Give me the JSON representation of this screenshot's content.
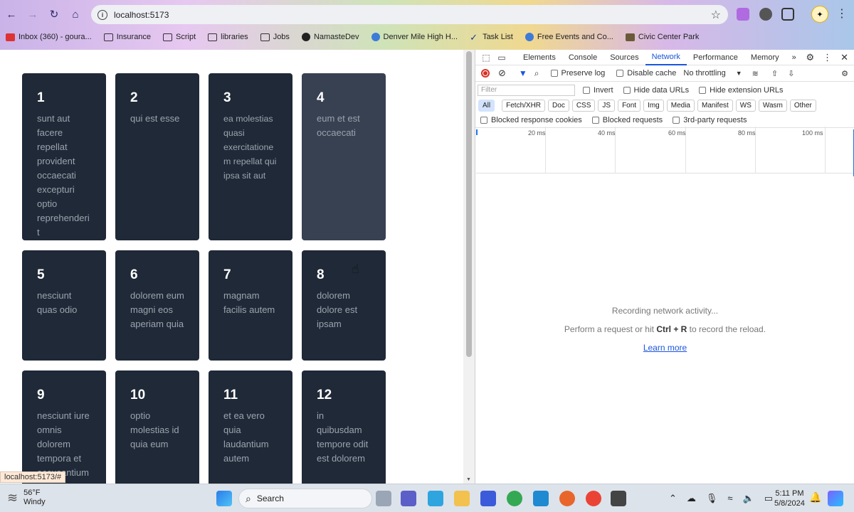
{
  "browser": {
    "url": "localhost:5173",
    "bookmarks": [
      {
        "label": "Inbox (360) - goura...",
        "icon": "gmail-icon"
      },
      {
        "label": "Insurance",
        "icon": "folder-icon"
      },
      {
        "label": "Script",
        "icon": "folder-icon"
      },
      {
        "label": "libraries",
        "icon": "folder-icon"
      },
      {
        "label": "Jobs",
        "icon": "folder-icon"
      },
      {
        "label": "NamasteDev",
        "icon": "namastedev-icon"
      },
      {
        "label": "Denver Mile High H...",
        "icon": "globe-icon"
      },
      {
        "label": "Task List",
        "icon": "check-icon"
      },
      {
        "label": "Free Events and Co...",
        "icon": "globe-icon"
      },
      {
        "label": "Civic Center Park",
        "icon": "park-icon"
      }
    ],
    "status_url": "localhost:5173/#"
  },
  "cards": [
    {
      "id": "1",
      "title": "sunt aut facere repellat provident occaecati excepturi optio reprehenderit"
    },
    {
      "id": "2",
      "title": "qui est esse"
    },
    {
      "id": "3",
      "title": "ea molestias quasi exercitationem repellat qui ipsa sit aut"
    },
    {
      "id": "4",
      "title": "eum et est occaecati"
    },
    {
      "id": "5",
      "title": "nesciunt quas odio"
    },
    {
      "id": "6",
      "title": "dolorem eum magni eos aperiam quia"
    },
    {
      "id": "7",
      "title": "magnam facilis autem"
    },
    {
      "id": "8",
      "title": "dolorem dolore est ipsam"
    },
    {
      "id": "9",
      "title": "nesciunt iure omnis dolorem tempora et accusantium"
    },
    {
      "id": "10",
      "title": "optio molestias id quia eum"
    },
    {
      "id": "11",
      "title": "et ea vero quia laudantium autem"
    },
    {
      "id": "12",
      "title": "in quibusdam tempore odit est dolorem"
    }
  ],
  "devtools": {
    "tabs": [
      "Elements",
      "Console",
      "Sources",
      "Network",
      "Performance",
      "Memory"
    ],
    "active_tab": "Network",
    "controls": {
      "preserve_log": "Preserve log",
      "disable_cache": "Disable cache",
      "throttling": "No throttling"
    },
    "filter": {
      "placeholder": "Filter",
      "invert": "Invert",
      "hide_data_urls": "Hide data URLs",
      "hide_extension_urls": "Hide extension URLs"
    },
    "types": [
      "All",
      "Fetch/XHR",
      "Doc",
      "CSS",
      "JS",
      "Font",
      "Img",
      "Media",
      "Manifest",
      "WS",
      "Wasm",
      "Other"
    ],
    "blocked": {
      "cookies": "Blocked response cookies",
      "requests": "Blocked requests",
      "third_party": "3rd-party requests"
    },
    "timeline_ticks": [
      "20 ms",
      "40 ms",
      "60 ms",
      "80 ms",
      "100 ms"
    ],
    "empty": {
      "recording": "Recording network activity...",
      "perform_prefix": "Perform a request or hit",
      "shortcut": "Ctrl + R",
      "perform_suffix": "to record the reload.",
      "learn_more": "Learn more"
    }
  },
  "taskbar": {
    "temperature": "56°F",
    "condition": "Windy",
    "search": "Search",
    "time": "5:11 PM",
    "date": "5/8/2024"
  },
  "colors": {
    "card_bg": "#1f2937",
    "card_hover_bg": "#374151",
    "card_text": "#9ca3af",
    "devtools_accent": "#1a56db"
  }
}
